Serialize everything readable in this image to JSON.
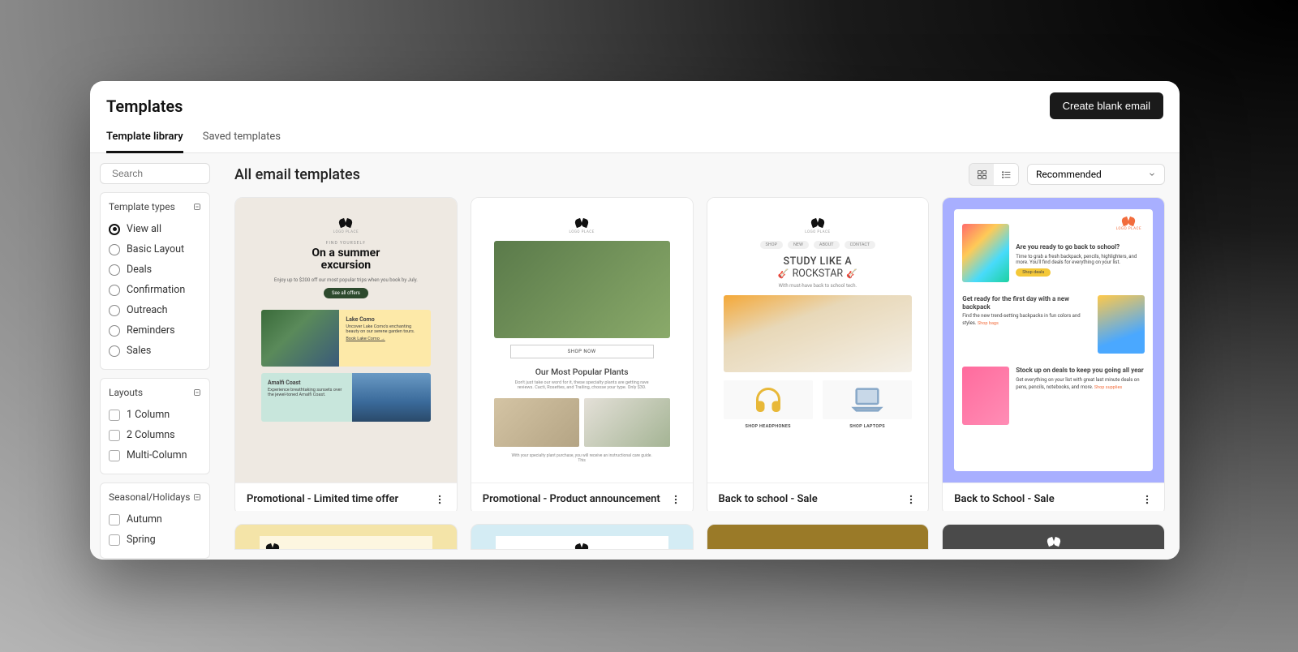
{
  "header": {
    "title": "Templates",
    "create_button": "Create blank email"
  },
  "tabs": [
    {
      "label": "Template library",
      "active": true
    },
    {
      "label": "Saved templates",
      "active": false
    }
  ],
  "search": {
    "placeholder": "Search"
  },
  "filters": {
    "types": {
      "title": "Template types",
      "items": [
        {
          "label": "View all",
          "checked": true
        },
        {
          "label": "Basic Layout",
          "checked": false
        },
        {
          "label": "Deals",
          "checked": false
        },
        {
          "label": "Confirmation",
          "checked": false
        },
        {
          "label": "Outreach",
          "checked": false
        },
        {
          "label": "Reminders",
          "checked": false
        },
        {
          "label": "Sales",
          "checked": false
        }
      ]
    },
    "layouts": {
      "title": "Layouts",
      "items": [
        {
          "label": "1 Column"
        },
        {
          "label": "2 Columns"
        },
        {
          "label": "Multi-Column"
        }
      ]
    },
    "seasonal": {
      "title": "Seasonal/Holidays",
      "items": [
        {
          "label": "Autumn"
        },
        {
          "label": "Spring"
        }
      ]
    }
  },
  "content": {
    "title": "All email templates",
    "sort": {
      "selected": "Recommended"
    }
  },
  "cards": [
    {
      "title": "Promotional - Limited time offer",
      "preview": {
        "logo_text": "LOGO PLACE",
        "pre": "FIND YOURSELF",
        "headline_a": "On a summer",
        "headline_b": "excursion",
        "sub": "Enjoy up to $200 off our most popular trips when you book by July.",
        "cta": "See all offers",
        "tile1_title": "Lake Como",
        "tile1_body": "Uncover Lake Como's enchanting beauty on our serene garden tours.",
        "tile1_link": "Book Lake Como →",
        "tile2_title": "Amalfi Coast",
        "tile2_body": "Experience breathtaking sunsets over the jewel-toned Amalfi Coast."
      }
    },
    {
      "title": "Promotional - Product announcement",
      "preview": {
        "logo_text": "LOGO PLACE",
        "shop_now": "SHOP NOW",
        "headline": "Our Most Popular Plants",
        "body": "Don't just take our word for it, these specialty plants are getting rave reviews. Cacti, Rosettes, and Trailing, choose your type. Only $30.",
        "footer": "With your specialty plant purchase, you will receive an instructional care guide. This"
      }
    },
    {
      "title": "Back to school - Sale",
      "preview": {
        "logo_text": "LOGO PLACE",
        "nav": [
          "SHOP",
          "NEW",
          "ABOUT",
          "CONTACT"
        ],
        "headline_a": "STUDY LIKE A",
        "headline_b": "ROCKSTAR",
        "sub": "With must-have back to school tech.",
        "prod1": "SHOP HEADPHONES",
        "prod2": "SHOP LAPTOPS"
      }
    },
    {
      "title": "Back to School - Sale",
      "preview": {
        "logo_text": "LOGO PLACE",
        "row1_head": "Are you ready to go back to school?",
        "row1_body": "Time to grab a fresh backpack, pencils, highlighters, and more. You'll find deals for everything on your list.",
        "row1_cta": "Shop deals",
        "row2_head": "Get ready for the first day with a new backpack",
        "row2_body": "Find the new trend-setting backpacks in fun colors and styles.",
        "row2_link": "Shop bags",
        "row3_head": "Stock up on deals to keep you going all year",
        "row3_body": "Get everything on your list with great last minute deals on pens, pencils, notebooks, and more.",
        "row3_link": "Shop supplies"
      }
    }
  ]
}
